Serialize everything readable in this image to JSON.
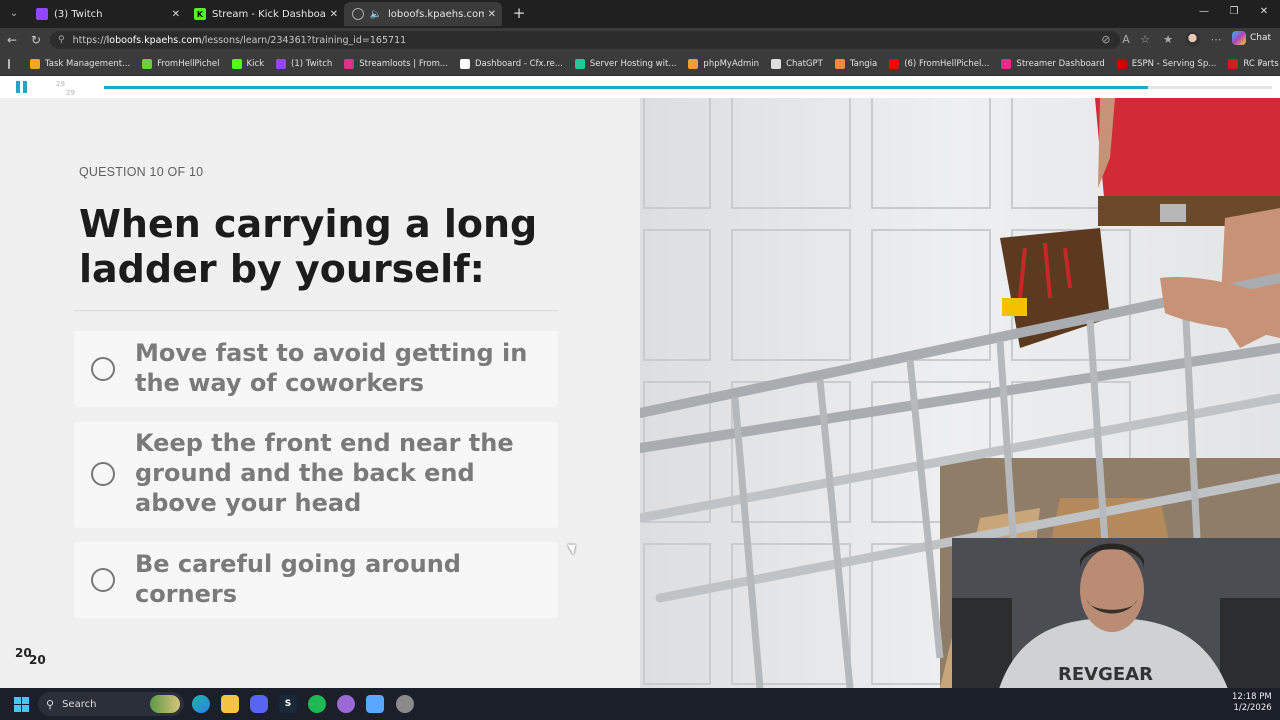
{
  "browser": {
    "tabs": [
      {
        "title": "(3) Twitch",
        "favicon": "twitch-icon",
        "color": "#9146ff",
        "active": false
      },
      {
        "title": "Stream - Kick Dashboard",
        "favicon": "kick-icon",
        "color": "#53fc18",
        "active": false
      },
      {
        "title": "loboofs.kpaehs.com/lessons/l",
        "favicon": "globe-icon",
        "color": "#888888",
        "active": true
      }
    ],
    "url": {
      "prefix": "https://",
      "host": "loboofs.kpaehs.com",
      "path": "/lessons/learn/234361?training_id=165711"
    },
    "copilot_label": "Chat",
    "bookmarks": [
      {
        "label": "Task Management...",
        "icon": "task-icon",
        "color": "#f5a623"
      },
      {
        "label": "FromHellPichel",
        "icon": "play-icon",
        "color": "#6ccf3c"
      },
      {
        "label": "Kick",
        "icon": "kick-icon",
        "color": "#53fc18"
      },
      {
        "label": "(1) Twitch",
        "icon": "twitch-icon",
        "color": "#9146ff"
      },
      {
        "label": "Streamloots | From...",
        "icon": "streamloots-icon",
        "color": "#e0318a"
      },
      {
        "label": "Dashboard - Cfx.re...",
        "icon": "cfx-icon",
        "color": "#ffffff"
      },
      {
        "label": "Server Hosting wit...",
        "icon": "server-icon",
        "color": "#20c997"
      },
      {
        "label": "phpMyAdmin",
        "icon": "phpmyadmin-icon",
        "color": "#f0a030"
      },
      {
        "label": "ChatGPT",
        "icon": "chatgpt-icon",
        "color": "#dddddd"
      },
      {
        "label": "Tangia",
        "icon": "tangia-icon",
        "color": "#ff8a3d"
      },
      {
        "label": "(6) FromHellPichel...",
        "icon": "youtube-icon",
        "color": "#ff0000"
      },
      {
        "label": "Streamer Dashboard",
        "icon": "streamer-icon",
        "color": "#e0318a"
      },
      {
        "label": "ESPN - Serving Sp...",
        "icon": "espn-icon",
        "color": "#d00000"
      },
      {
        "label": "RC Parts | RC Car P...",
        "icon": "rc-icon",
        "color": "#cc1f1f"
      }
    ]
  },
  "lesson": {
    "page_current": "29",
    "page_total": "29",
    "progress_fraction": 0.894,
    "accent": "#1fa7c9",
    "question_label": "QUESTION 10 OF 10",
    "question_title": "When carrying a long ladder by yourself:",
    "options": [
      {
        "text": "Move fast to avoid getting in the way of coworkers"
      },
      {
        "text": "Keep the front end near the ground and the back end above your head"
      },
      {
        "text": "Be careful going around corners"
      }
    ],
    "score_num": "20",
    "score_den": "20",
    "photo_logo_text": "REVGEAR"
  },
  "taskbar": {
    "search_label": "Search",
    "time": "12:18 PM",
    "date": "1/2/2026"
  }
}
